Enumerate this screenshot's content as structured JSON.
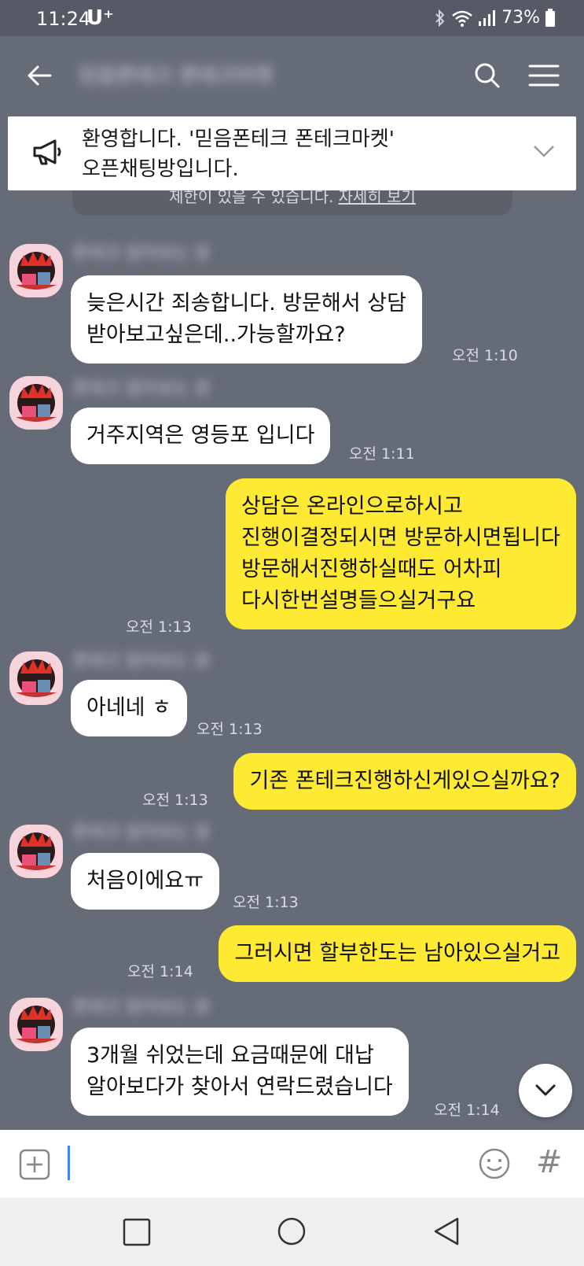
{
  "status": {
    "time": "11:24",
    "carrier": "U⁺",
    "battery": "73%"
  },
  "header": {
    "title": "믿음폰테크 폰테크마켓"
  },
  "notice": {
    "text_line1": "환영합니다. '믿음폰테크 폰테크마켓'",
    "text_line2": "오픈채팅방입니다.",
    "strip_text": "제한이 있을 수 있습니다.",
    "strip_link": "자세히 보기"
  },
  "sender_name": "폰테크 알아보는 분",
  "messages": [
    {
      "from": "in",
      "lines": [
        "늦은시간 죄송합니다. 방문해서 상담",
        "받아보고싶은데..가능할까요?"
      ],
      "time": "오전 1:10"
    },
    {
      "from": "in",
      "lines": [
        "거주지역은 영등포 입니다"
      ],
      "time": "오전 1:11"
    },
    {
      "from": "out",
      "lines": [
        "상담은 온라인으로하시고",
        "진행이결정되시면 방문하시면됩니다",
        "방문해서진행하실때도 어차피",
        "다시한번설명들으실거구요"
      ],
      "time": "오전 1:13"
    },
    {
      "from": "in",
      "lines": [
        "아네네 ㅎ"
      ],
      "time": "오전 1:13"
    },
    {
      "from": "out",
      "lines": [
        "기존 폰테크진행하신게있으실까요?"
      ],
      "time": "오전 1:13"
    },
    {
      "from": "in",
      "lines": [
        "처음이에요ㅠ"
      ],
      "time": "오전 1:13"
    },
    {
      "from": "out",
      "lines": [
        "그러시면 할부한도는 남아있으실거고"
      ],
      "time": "오전 1:14"
    },
    {
      "from": "in",
      "lines": [
        "3개월  쉬었는데 요금때문에 대납",
        "알아보다가 찾아서 연락드렸습니다"
      ],
      "time": "오전 1:14"
    }
  ],
  "input": {
    "placeholder": "",
    "hash_label": "#"
  },
  "colors": {
    "bg": "#666b78",
    "in_bubble": "#ffffff",
    "out_bubble": "#fee933",
    "avatar_bg": "#f7d4dc"
  }
}
